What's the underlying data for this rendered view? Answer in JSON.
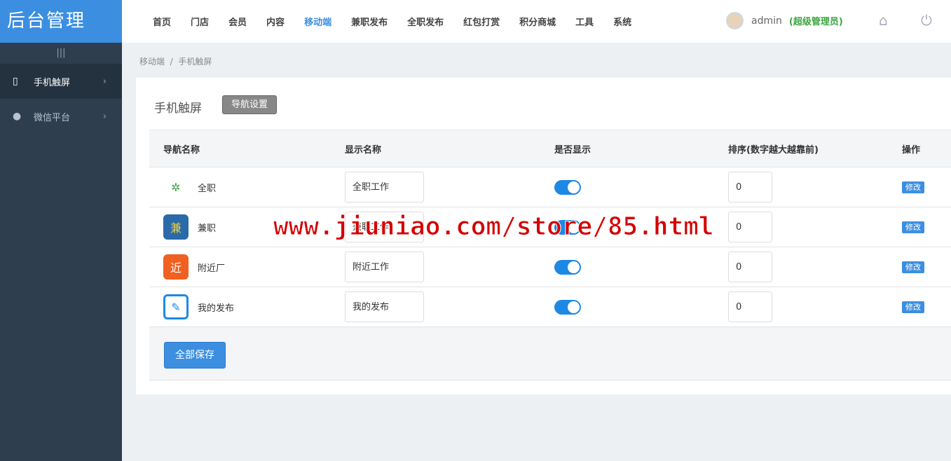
{
  "sidebar": {
    "logo": "后台管理",
    "fold": "|||",
    "items": [
      {
        "label": "手机触屏",
        "icon": "phone-icon"
      },
      {
        "label": "微信平台",
        "icon": "wechat-icon"
      }
    ]
  },
  "topnav": {
    "items": [
      "首页",
      "门店",
      "会员",
      "内容",
      "移动端",
      "兼职发布",
      "全职发布",
      "红包打赏",
      "积分商城",
      "工具",
      "系统"
    ],
    "active": "移动端"
  },
  "user": {
    "name": "admin",
    "role": "(超级管理员)"
  },
  "breadcrumb": [
    "移动端",
    "手机触屏"
  ],
  "panel": {
    "title": "手机触屏",
    "nav_button": "导航设置"
  },
  "table": {
    "headers": [
      "导航名称",
      "显示名称",
      "是否显示",
      "排序(数字越大越靠前)",
      "操作"
    ],
    "rows": [
      {
        "name": "全职",
        "display": "全职工作",
        "shown": true,
        "order": "0",
        "action": "修改",
        "icon_color": "#ffffff"
      },
      {
        "name": "兼职",
        "display": "兼职工作",
        "shown": true,
        "order": "0",
        "action": "修改",
        "icon_color": "#2a6aa8"
      },
      {
        "name": "附近厂",
        "display": "附近工作",
        "shown": true,
        "order": "0",
        "action": "修改",
        "icon_color": "#f06020"
      },
      {
        "name": "我的发布",
        "display": "我的发布",
        "shown": true,
        "order": "0",
        "action": "修改",
        "icon_color": "#ffffff"
      }
    ]
  },
  "save_button": "全部保存",
  "watermark": "www.jiuniao.com/store/85.html"
}
